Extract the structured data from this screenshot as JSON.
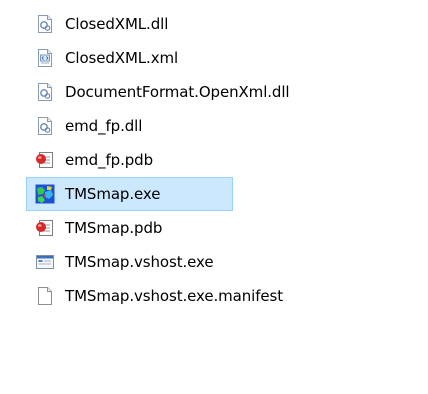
{
  "files": [
    {
      "name": "ClosedXML.dll",
      "icon": "dll-file-icon"
    },
    {
      "name": "ClosedXML.xml",
      "icon": "xml-file-icon"
    },
    {
      "name": "DocumentFormat.OpenXml.dll",
      "icon": "dll-file-icon"
    },
    {
      "name": "emd_fp.dll",
      "icon": "dll-file-icon"
    },
    {
      "name": "emd_fp.pdb",
      "icon": "pdb-file-icon"
    },
    {
      "name": "TMSmap.exe",
      "icon": "map-app-icon",
      "selected": true
    },
    {
      "name": "TMSmap.pdb",
      "icon": "pdb-file-icon"
    },
    {
      "name": "TMSmap.vshost.exe",
      "icon": "window-app-icon"
    },
    {
      "name": "TMSmap.vshost.exe.manifest",
      "icon": "blank-file-icon"
    }
  ]
}
